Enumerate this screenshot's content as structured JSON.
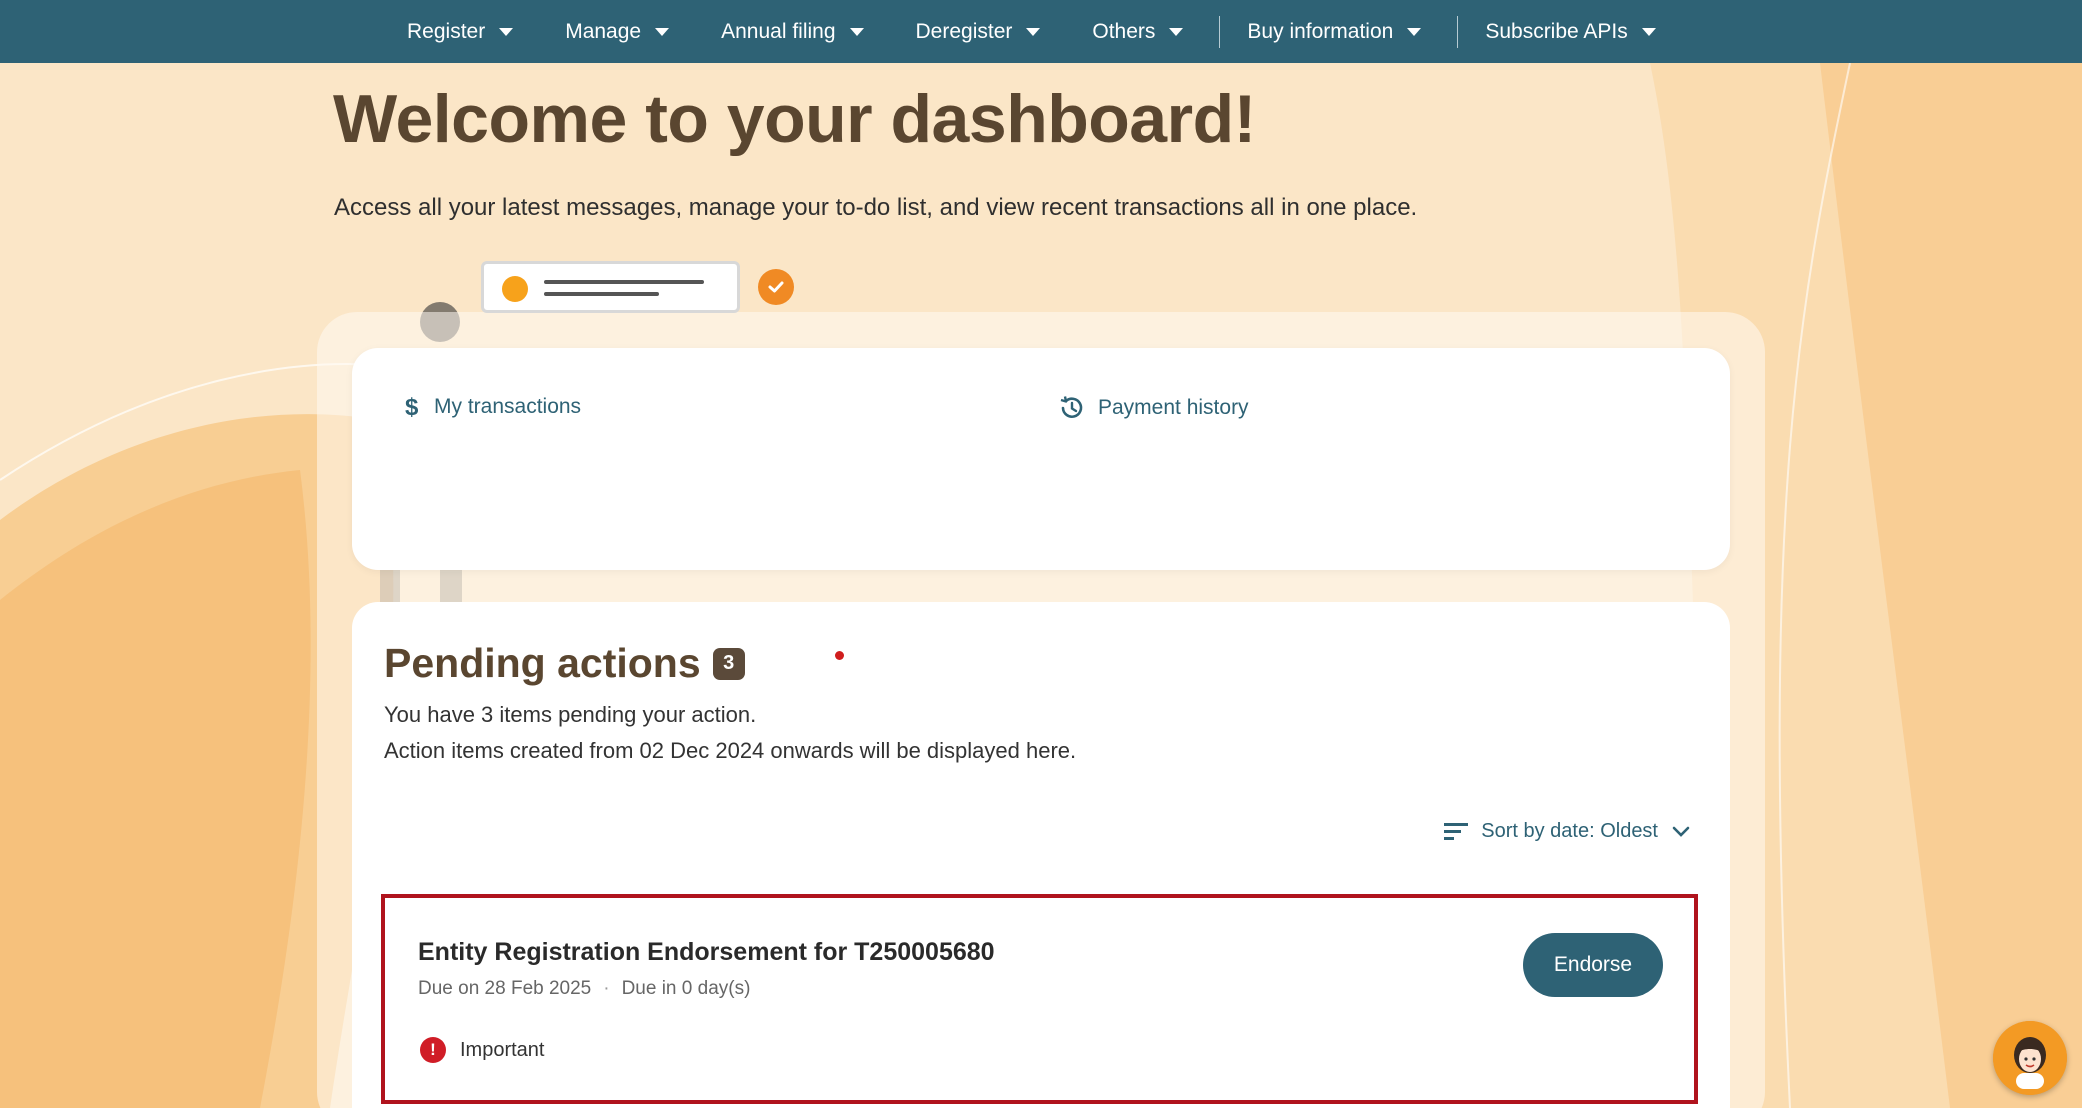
{
  "nav": {
    "items": [
      {
        "label": "Register"
      },
      {
        "label": "Manage"
      },
      {
        "label": "Annual filing"
      },
      {
        "label": "Deregister"
      },
      {
        "label": "Others"
      },
      {
        "label": "Buy information"
      },
      {
        "label": "Subscribe APIs"
      }
    ]
  },
  "hero": {
    "title": "Welcome to your dashboard!",
    "subtitle": "Access all your latest messages, manage your to-do list, and view recent transactions all in one place."
  },
  "transactions": {
    "my_transactions": "My transactions",
    "payment_history": "Payment history"
  },
  "pending": {
    "title": "Pending actions",
    "count": "3",
    "desc1": "You have 3 items pending your action.",
    "desc2": "Action items created from 02 Dec 2024 onwards will be displayed here.",
    "sort_label": "Sort by date: Oldest",
    "items": [
      {
        "title": "Entity Registration Endorsement for T250005680",
        "due": "Due on 28 Feb 2025",
        "due_in": "Due in 0 day(s)",
        "tag": "Important",
        "action": "Endorse"
      }
    ]
  },
  "colors": {
    "nav": "#2e6275",
    "accent": "#f7a21b",
    "highlight_border": "#b0131d",
    "heading": "#5a4630"
  }
}
